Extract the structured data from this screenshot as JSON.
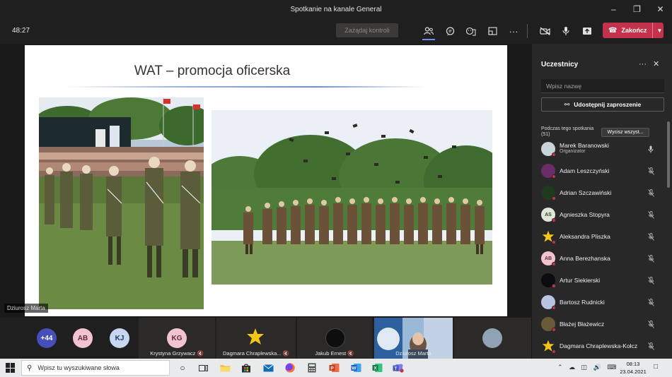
{
  "window": {
    "title": "Spotkanie na kanale General"
  },
  "toolbar": {
    "timer": "48:27",
    "request_control": "Zażądaj kontroli",
    "leave_label": "Zakończ"
  },
  "slide": {
    "title": "WAT – promocja oficerska"
  },
  "speaker": {
    "name": "Dziurosz Marta"
  },
  "strip": {
    "overflow_count": "+44",
    "avatars": [
      {
        "initials": "AB",
        "color": "#f2c4d0"
      },
      {
        "initials": "KJ",
        "color": "#c7d7f2"
      }
    ],
    "tiles": [
      {
        "name": "Krystyna Grzywacz",
        "initials": "KG"
      },
      {
        "name": "Dagmara Chraplewska...",
        "initials": ""
      },
      {
        "name": "Jakub Ernest",
        "initials": ""
      },
      {
        "name": "Dziurosz Marta",
        "initials": ""
      }
    ]
  },
  "panel": {
    "title": "Uczestnicy",
    "search_placeholder": "Wpisz nazwę",
    "share_label": "Udostępnij zaproszenie",
    "section_label": "Podczas tego spotkania (51)",
    "mute_all_label": "Wycisz wszyst...",
    "participants": [
      {
        "name": "Marek Baranowski",
        "role": "Organizator",
        "initials": "",
        "mic": "on"
      },
      {
        "name": "Adam Leszczyński",
        "role": "",
        "initials": "",
        "mic": "off"
      },
      {
        "name": "Adrian Szczawiński",
        "role": "",
        "initials": "",
        "mic": "off"
      },
      {
        "name": "Agnieszka Stopyra",
        "role": "",
        "initials": "AS",
        "mic": "off"
      },
      {
        "name": "Aleksandra Pliszka",
        "role": "",
        "initials": "",
        "mic": "off"
      },
      {
        "name": "Anna Berezhanska",
        "role": "",
        "initials": "AB",
        "mic": "off"
      },
      {
        "name": "Artur Siekierski",
        "role": "",
        "initials": "",
        "mic": "off"
      },
      {
        "name": "Bartosz Rudnicki",
        "role": "",
        "initials": "",
        "mic": "off"
      },
      {
        "name": "Błażej Błażewicz",
        "role": "",
        "initials": "",
        "mic": "off"
      },
      {
        "name": "Dagmara Chraplewska-Kołcz",
        "role": "",
        "initials": "",
        "mic": "off"
      }
    ]
  },
  "taskbar": {
    "search_placeholder": "Wpisz tu wyszukiwane słowa",
    "time": "08:13",
    "date": "23.04.2021"
  },
  "colors": {
    "accent": "#7f85f5",
    "leave": "#c4314b",
    "panel_bg": "#292828",
    "app_bg": "#201f1f"
  }
}
